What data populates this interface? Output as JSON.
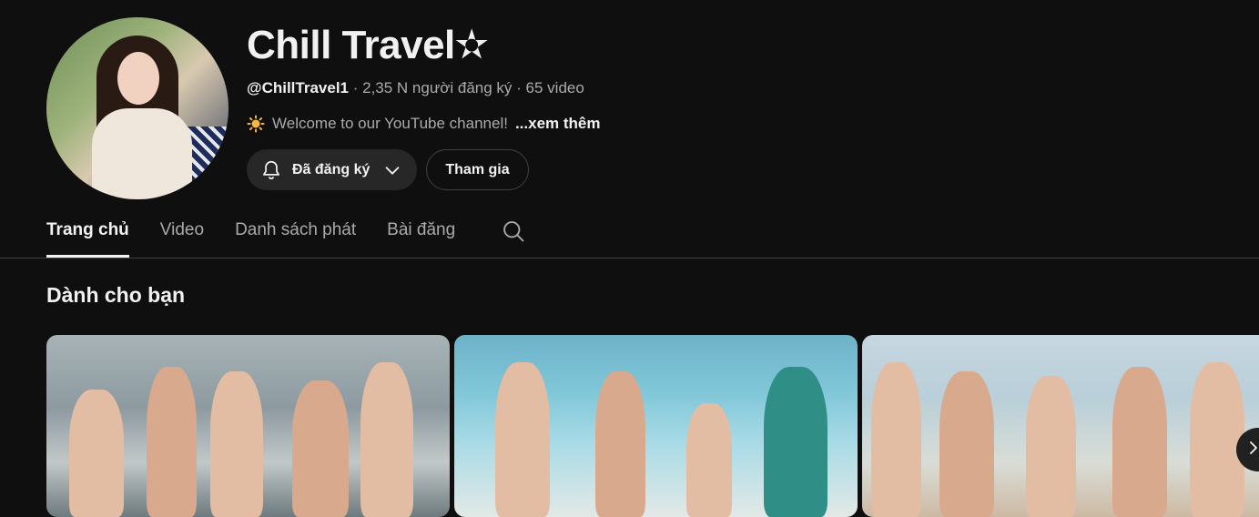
{
  "channel": {
    "title": "Chill Travel✫",
    "handle": "@ChillTravel1",
    "subscribers": " · 2,35 N người đăng ký · ",
    "video_count": "65 video",
    "description": "Welcome to our YouTube channel!",
    "more_label": "...xem thêm"
  },
  "buttons": {
    "subscribed_label": "Đã đăng ký",
    "join_label": "Tham gia"
  },
  "tabs": [
    {
      "label": "Trang chủ",
      "active": true
    },
    {
      "label": "Video"
    },
    {
      "label": "Danh sách phát"
    },
    {
      "label": "Bài đăng"
    }
  ],
  "section": {
    "title": "Dành cho bạn"
  },
  "icons": {
    "bell": "bell-icon",
    "chevron": "chevron-down-icon",
    "search": "search-icon",
    "sun": "sun-emoji-icon",
    "next": "chevron-right-icon"
  }
}
